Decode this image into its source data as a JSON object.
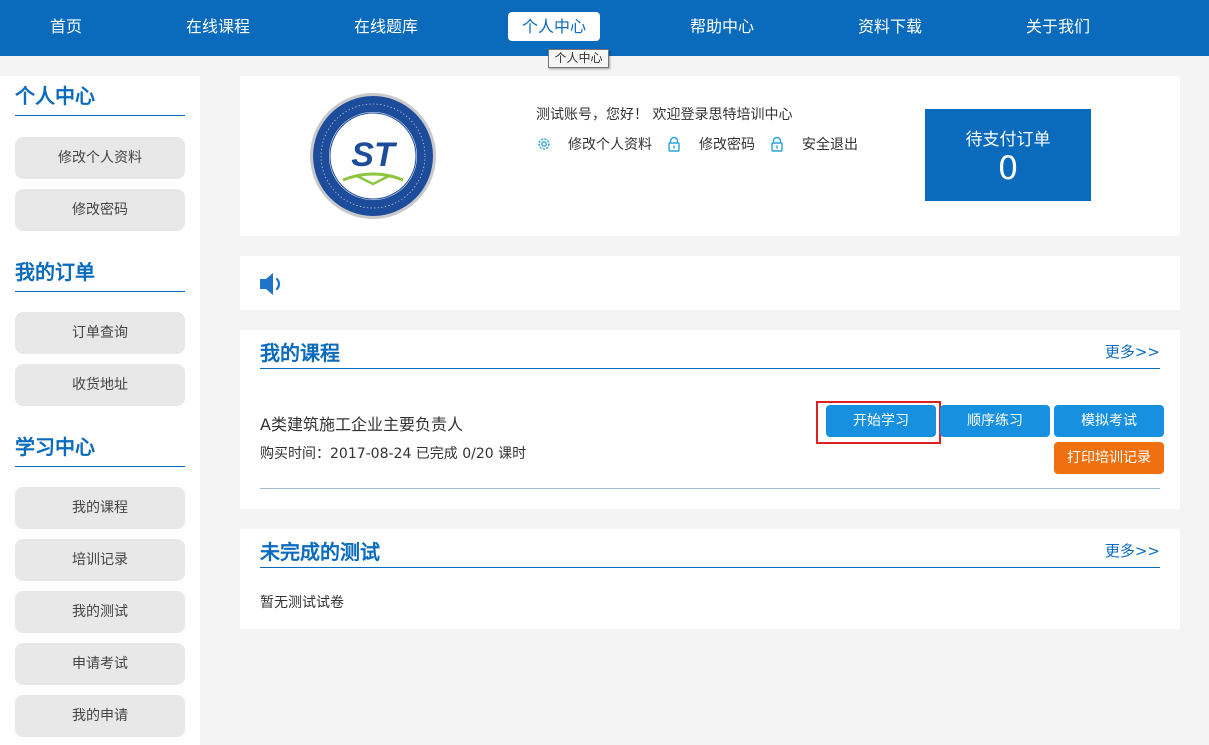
{
  "nav": {
    "items": [
      {
        "label": "首页"
      },
      {
        "label": "在线课程"
      },
      {
        "label": "在线题库"
      },
      {
        "label": "个人中心"
      },
      {
        "label": "帮助中心"
      },
      {
        "label": "资料下载"
      },
      {
        "label": "关于我们"
      }
    ],
    "active_tooltip": "个人中心"
  },
  "sidebar": {
    "sections": [
      {
        "title": "个人中心",
        "items": [
          {
            "label": "修改个人资料"
          },
          {
            "label": "修改密码"
          }
        ]
      },
      {
        "title": "我的订单",
        "items": [
          {
            "label": "订单查询"
          },
          {
            "label": "收货地址"
          }
        ]
      },
      {
        "title": "学习中心",
        "items": [
          {
            "label": "我的课程"
          },
          {
            "label": "培训记录"
          },
          {
            "label": "我的测试"
          },
          {
            "label": "申请考试"
          },
          {
            "label": "我的申请"
          }
        ]
      }
    ]
  },
  "profile": {
    "logo_text": "ST",
    "greeting": "测试账号，您好！  欢迎登录思特培训中心",
    "links": [
      {
        "label": "修改个人资料",
        "icon": "gear-icon"
      },
      {
        "label": "修改密码",
        "icon": "lock-icon"
      },
      {
        "label": "安全退出",
        "icon": "lock-icon"
      }
    ],
    "pending_orders": {
      "label": "待支付订单",
      "count": "0"
    }
  },
  "notice": {
    "icon": "speaker-icon"
  },
  "courses": {
    "title": "我的课程",
    "more": "更多>>",
    "items": [
      {
        "name": "A类建筑施工企业主要负责人",
        "meta": "购买时间：2017-08-24 已完成 0/20 课时",
        "buttons": {
          "start": "开始学习",
          "sequence": "顺序练习",
          "mock": "模拟考试",
          "print": "打印培训记录"
        }
      }
    ]
  },
  "tests": {
    "title": "未完成的测试",
    "more": "更多>>",
    "empty": "暂无测试试卷"
  },
  "colors": {
    "primary": "#0a6bbd",
    "button_blue": "#1790e0",
    "button_orange": "#f07010",
    "highlight": "#e02020"
  }
}
